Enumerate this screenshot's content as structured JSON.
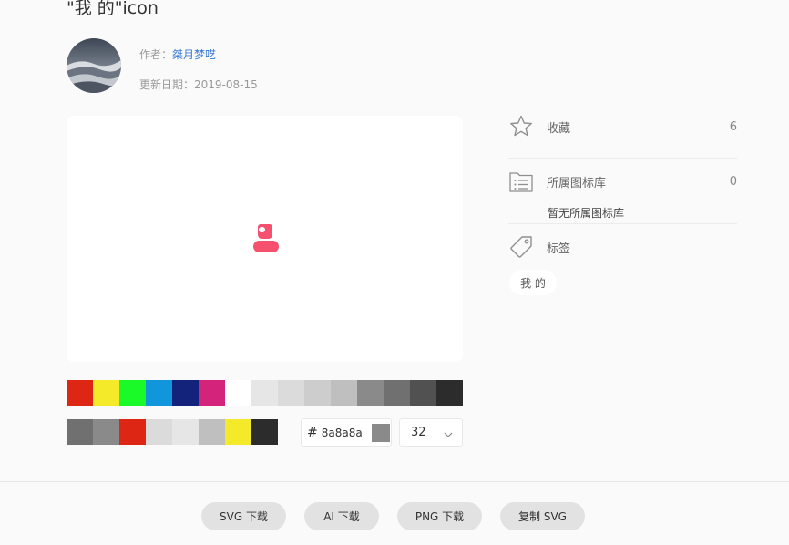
{
  "page": {
    "title": "\"我 的\"icon"
  },
  "author": {
    "label": "作者：",
    "name": "桀月梦呓"
  },
  "updated": {
    "label": "更新日期：",
    "date": "2019-08-15"
  },
  "preview": {
    "icon": "user-icon",
    "icon_color": "#f5506e"
  },
  "palette": {
    "row1": [
      "#dd2613",
      "#f4ea2a",
      "#1afa29",
      "#1296db",
      "#13227a",
      "#d4237a",
      "#ffffff",
      "#e6e6e6",
      "#dbdbdb",
      "#cdcdcd",
      "#bfbfbf",
      "#8a8a8a",
      "#707070",
      "#515151",
      "#2c2c2c"
    ],
    "row2": [
      "#707070",
      "#8a8a8a",
      "#dd2613",
      "#dbdbdb",
      "#e6e6e6",
      "#bfbfbf",
      "#f4ea2a",
      "#2c2c2c"
    ]
  },
  "color_input": {
    "hash": "#",
    "value": "8a8a8a",
    "swatch": "#8a8a8a"
  },
  "size_select": {
    "value": "32"
  },
  "sidebar": {
    "favorite": {
      "label": "收藏",
      "count": "6",
      "icon": "star-icon"
    },
    "library": {
      "label": "所属图标库",
      "count": "0",
      "icon": "folder-list-icon",
      "note": "暂无所属图标库"
    },
    "tags": {
      "label": "标签",
      "icon": "tag-icon",
      "items": [
        "我 的"
      ]
    }
  },
  "actions": {
    "svg_download": "SVG 下载",
    "ai_download": "AI 下载",
    "png_download": "PNG 下载",
    "copy_svg": "复制 SVG"
  }
}
